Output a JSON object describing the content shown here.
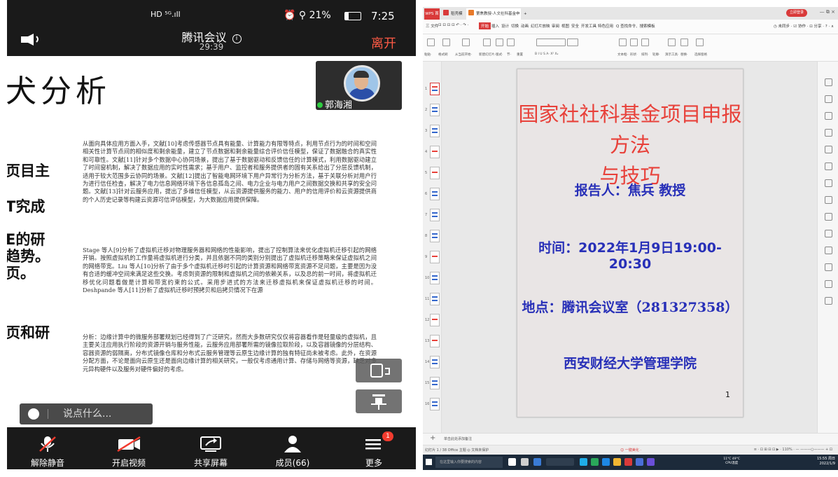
{
  "phone": {
    "status": {
      "carrier": "HD ⁵ᴳ.ıll",
      "indicators": "⏰ ⚲ 21%",
      "time": "7:25"
    },
    "meeting": {
      "title": "腾讯会议",
      "info": "i",
      "elapsed": "29:39",
      "leave": "离开"
    },
    "presenter": {
      "name": "郭海湘"
    },
    "doc": {
      "heading": "犬分析",
      "cut_lines": [
        "页目主",
        "T究成",
        "E的研",
        "趋势。",
        "页。",
        "页和研"
      ],
      "para1": "从面向具体应用方面入手，文献[10]考虑传感器节点具有能量、计算能力有限等特点，利用节点行为的时间和空间相关性计算节点间的相似度和剩余能量，建立了节点数据和剩余能量综合评价信任模型，保证了数据融合的真实性和可靠性。文献[11]针对多个数据中心协同场景，提出了基于数据驱动和反馈信任的计算模式，利用数据驱动建立了时间窗机制，解决了数据应用的实时性需求；基于用户、监控者和服务提供者的固有关系给出了分层反馈机制，适用于较大范围多云协同的场景。文献[12]提出了智能电网环境下用户异常行为分析方法，基于关联分析对用户行为进行信任检查，解决了电力信息网络环境下各信息孤岛之间、电力企业与电力用户之间数据交换和共享的安全问题。文献[13]针对云服务应用，提出了多维信任模型，从云资源提供服务的能力、用户的信用评价和云资源提供商的个人历史记录等构建云资源可信评估模型，为大数据应用提供保障。",
      "para2": "Stage 等人[9]分析了虚拟机迁移对物理服务器和网络的性能影响，提出了控制算法来优化虚拟机迁移引起的网络开销。按照虚拟机的工作量将虚拟机进行分类，并且依据不同的类别分别提出了虚拟机迁移策略来保证虚拟机之间的网络带宽。Liu 等人[10]分析了由于多个虚拟机迁移时引起的计算资源和网络带宽资源不足问题，主要是因为没有合适的缓冲空间来满足这些交换。考虑到资源的限制和虚拟机之间的依赖关系，以及总的前一时间，将虚拟机迁移优化问题看做是计算和带宽约束的公式。采用步进式的方法来迁移虚拟机来保证虚拟机迁移的时间。Deshpande 等人[11]分析了虚拟机迁移时预拷贝和后拷贝情况下在源",
      "para3": "分析：边缘计算中的微服务部署规划已经得到了广泛研究，然而大多数研究仅仅将容器看作是轻量级的虚拟机，且主要关注应用执行阶段的资源开销与服务性能，云服务应用部署所需的镜像拉取阶段，以及容器镜像的分层结构、容器资源的弱隔离，分布式镜像仓库和分布式云服务管理等云原生边缘计算的独有特征尚未被考虑。此外，在资源分配方面，不论是面向云原生还是面向边缘计算的相关研究，一般仅考虑通用计算、存储与网络等资源，缺乏对多元异构硬件以及服务对硬件偏好的考虑。"
    },
    "chat_placeholder": "说点什么...",
    "toolbar": [
      {
        "label": "解除静音",
        "icon": "mic-off-icon"
      },
      {
        "label": "开启视频",
        "icon": "camera-off-icon"
      },
      {
        "label": "共享屏幕",
        "icon": "share-screen-icon"
      },
      {
        "label": "成员(66)",
        "icon": "members-icon"
      },
      {
        "label": "更多",
        "icon": "more-icon",
        "badge": "1"
      }
    ]
  },
  "wps": {
    "tabs": {
      "home": "WPS 首页",
      "tab1": "稻壳模板",
      "tab2": "第焦教授-人文社科基金申报--12月 ·",
      "close": "×",
      "plus": "+"
    },
    "login": "立即登录",
    "window_buttons": "—  ⧉  ×",
    "menu": [
      "三 文件",
      "⊡ ⊡ ⊡ ⊡ ↶ · ↷ ·",
      "开始",
      "插入",
      "设计",
      "切换",
      "动画",
      "幻灯片放映",
      "审阅",
      "视图",
      "安全",
      "开发工具",
      "特色应用",
      "Q 查找命令、搜索模板"
    ],
    "menu_right": "◷ 未同步 · ☑ 协作 · ⊡ 分享 · ?  ·  ∧",
    "ribbon_labels": [
      "粘贴·",
      "格式刷",
      "从当前开始·",
      "新建幻灯片·",
      "版式·",
      "节·",
      "重置",
      "B I U S A· X² X₂",
      "文本框·",
      "形状·",
      "排列·",
      "轮廓·",
      "演示工具·",
      "替换·",
      "选择窗格"
    ],
    "slide_numbers": [
      "1",
      "2",
      "3",
      "4",
      "5",
      "6",
      "7",
      "8",
      "9",
      "10",
      "11",
      "12",
      "13",
      "14",
      "15",
      "16"
    ],
    "slide": {
      "title_line1": "国家社社科基金项目申报方法",
      "title_line2": "与技巧",
      "reporter": "报告人：焦兵 教授",
      "time": "时间：2022年1月9日19:00-20:30",
      "place": "地点：腾讯会议室（281327358）",
      "org": "西安财经大学管理学院",
      "page": "1"
    },
    "notes": "单击此处添加备注",
    "status": {
      "left": "幻灯片 1 / 38   Office 主题   ◎ 文档未保护",
      "center": "☺ 一键美化 ·",
      "right": "≡ · ⊡ ⊞ ⊟ ⊡ ▶ ·  110% · — ———○——— + ⊡"
    },
    "taskbar": {
      "search": "在这里输入你要搜索的内容",
      "tray": "11°C  49°C",
      "tray2": "CPU温度",
      "clock_time": "15:55 周日",
      "clock_date": "2022/1/9"
    }
  },
  "colors": {
    "wps_red": "#d93a3a",
    "slide_title": "#e8413a",
    "slide_text": "#2830b8",
    "leave": "#ff5b45"
  }
}
